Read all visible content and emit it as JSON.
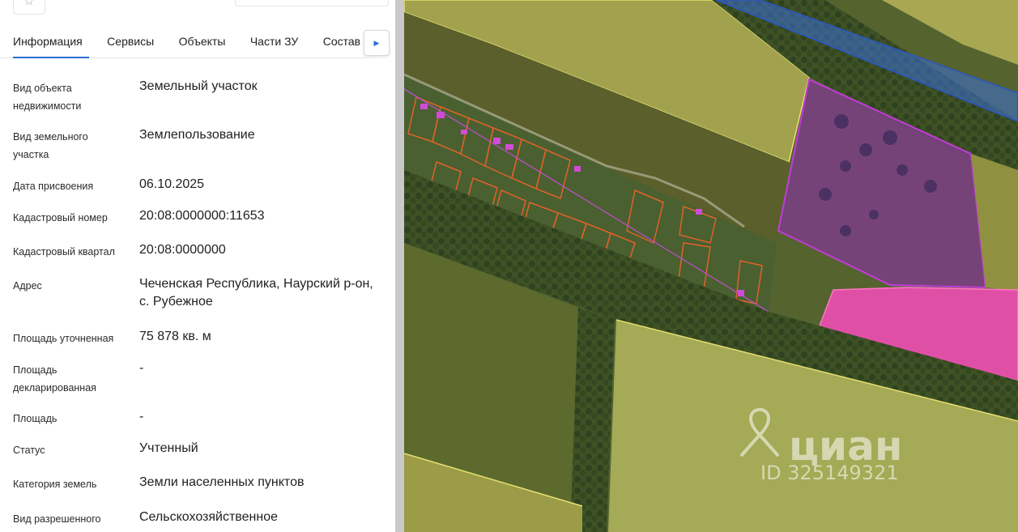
{
  "tabs": {
    "items": [
      {
        "label": "Информация"
      },
      {
        "label": "Сервисы"
      },
      {
        "label": "Объекты"
      },
      {
        "label": "Части ЗУ"
      },
      {
        "label": "Состав"
      }
    ],
    "next_icon": "chevron-right-icon"
  },
  "favorite_icon": "star-icon",
  "properties": [
    {
      "label": "Вид объекта недвижимости",
      "value": "Земельный участок"
    },
    {
      "label": "Вид земельного участка",
      "value": "Землепользование"
    },
    {
      "label": "Дата присвоения",
      "value": "06.10.2025"
    },
    {
      "label": "Кадастровый номер",
      "value": "20:08:0000000:11653"
    },
    {
      "label": "Кадастровый квартал",
      "value": "20:08:0000000"
    },
    {
      "label": "Адрес",
      "value": "Чеченская Республика, Наурский р-он, с. Рубежное"
    },
    {
      "label": "Площадь уточненная",
      "value": "75 878 кв. м"
    },
    {
      "label": "Площадь декларированная",
      "value": "-"
    },
    {
      "label": "Площадь",
      "value": "-"
    },
    {
      "label": "Статус",
      "value": "Учтенный"
    },
    {
      "label": "Категория земель",
      "value": "Земли населенных пунктов"
    },
    {
      "label": "Вид разрешенного",
      "value": "Сельскохозяйственное"
    }
  ],
  "watermark": {
    "brand": "циан",
    "id_text": "ID 325149321",
    "icon": "location-pin-icon"
  },
  "colors": {
    "accent": "#2d6fd6",
    "selected_parcel": "#b42cc4",
    "parcel_pink": "#e9449e",
    "parcel_outline": "#e0622a",
    "water_zone": "#3a6fd8",
    "field_yellow": "#b8b05a"
  }
}
